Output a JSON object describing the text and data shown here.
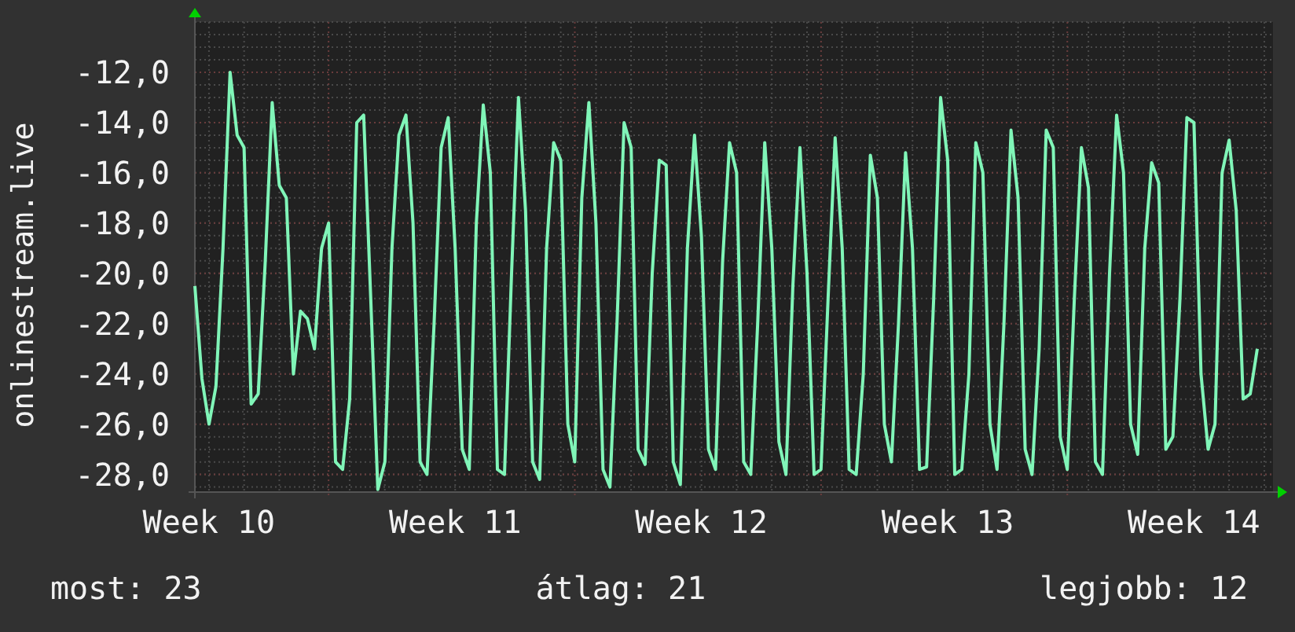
{
  "chart": {
    "chart_data": {
      "type": "line",
      "ylabel": "onlinestream.live",
      "ylim": [
        -28.7,
        -10
      ],
      "grid": true,
      "yticks": [
        {
          "value": -12,
          "label": "-12,0"
        },
        {
          "value": -14,
          "label": "-14,0"
        },
        {
          "value": -16,
          "label": "-16,0"
        },
        {
          "value": -18,
          "label": "-18,0"
        },
        {
          "value": -20,
          "label": "-20,0"
        },
        {
          "value": -22,
          "label": "-22,0"
        },
        {
          "value": -24,
          "label": "-24,0"
        },
        {
          "value": -26,
          "label": "-26,0"
        },
        {
          "value": -28,
          "label": "-28,0"
        }
      ],
      "categories": [
        null,
        null,
        "Week 10",
        null,
        null,
        null,
        null,
        null,
        null,
        null,
        null,
        null,
        null,
        null,
        null,
        null,
        null,
        null,
        null,
        null,
        null,
        null,
        null,
        null,
        null,
        null,
        null,
        null,
        null,
        null,
        null,
        null,
        null,
        null,
        null,
        null,
        null,
        "Week 11",
        null,
        null,
        null,
        null,
        null,
        null,
        null,
        null,
        null,
        null,
        null,
        null,
        null,
        null,
        null,
        null,
        null,
        null,
        null,
        null,
        null,
        null,
        null,
        null,
        null,
        null,
        null,
        null,
        null,
        null,
        null,
        null,
        null,
        null,
        "Week 12",
        null,
        null,
        null,
        null,
        null,
        null,
        null,
        null,
        null,
        null,
        null,
        null,
        null,
        null,
        null,
        null,
        null,
        null,
        null,
        null,
        null,
        null,
        null,
        null,
        null,
        null,
        null,
        null,
        null,
        null,
        null,
        null,
        null,
        null,
        "Week 13",
        null,
        null,
        null,
        null,
        null,
        null,
        null,
        null,
        null,
        null,
        null,
        null,
        null,
        null,
        null,
        null,
        null,
        null,
        null,
        null,
        null,
        null,
        null,
        null,
        null,
        null,
        null,
        null,
        null,
        null,
        null,
        null,
        null,
        null,
        "Week 14",
        null,
        null,
        null,
        null,
        null,
        null,
        null,
        null,
        null
      ],
      "series": [
        {
          "color": "#80f5b8",
          "values": [
            -20.5,
            -24.2,
            -26,
            -24.5,
            -19,
            -12,
            -14.5,
            -15,
            -25.2,
            -24.8,
            -19.5,
            -13.2,
            -16.5,
            -17,
            -24,
            -21.5,
            -21.8,
            -23,
            -19,
            -18,
            -27.5,
            -27.8,
            -25,
            -14,
            -13.7,
            -21,
            -28.6,
            -27.5,
            -19,
            -14.5,
            -13.7,
            -18,
            -27.5,
            -28,
            -22,
            -15,
            -13.8,
            -19,
            -27,
            -27.8,
            -18,
            -13.3,
            -16,
            -27.8,
            -28,
            -20,
            -13,
            -17.5,
            -27.5,
            -28.2,
            -19,
            -14.8,
            -15.5,
            -26,
            -27.5,
            -17,
            -13.2,
            -18,
            -27.8,
            -28.5,
            -22,
            -14,
            -15,
            -27,
            -27.6,
            -20,
            -15.5,
            -15.7,
            -27.5,
            -28.4,
            -19,
            -14.5,
            -18.5,
            -27,
            -27.8,
            -19.5,
            -14.8,
            -16,
            -27.5,
            -28,
            -22,
            -14.8,
            -19,
            -26.7,
            -28,
            -20.5,
            -15,
            -20,
            -28,
            -27.8,
            -21,
            -14.6,
            -19,
            -27.8,
            -28,
            -24,
            -15.3,
            -17,
            -26,
            -27.5,
            -22,
            -15.2,
            -19,
            -27.8,
            -27.7,
            -21,
            -13,
            -15.5,
            -28,
            -27.8,
            -24,
            -14.8,
            -16,
            -26,
            -27.8,
            -22,
            -14.3,
            -17,
            -27,
            -28,
            -23,
            -14.3,
            -15,
            -26.5,
            -27.8,
            -21,
            -15,
            -16.6,
            -27.5,
            -28,
            -20,
            -13.7,
            -16,
            -26,
            -27.2,
            -19,
            -15.6,
            -16.4,
            -27,
            -26.5,
            -21,
            -13.8,
            -14,
            -24,
            -27,
            -26,
            -16,
            -14.7,
            -17.5,
            -25,
            -24.8,
            -23
          ]
        }
      ]
    }
  },
  "legend": [
    "most: 23",
    "átlag: 21",
    "legjobb: 12"
  ]
}
